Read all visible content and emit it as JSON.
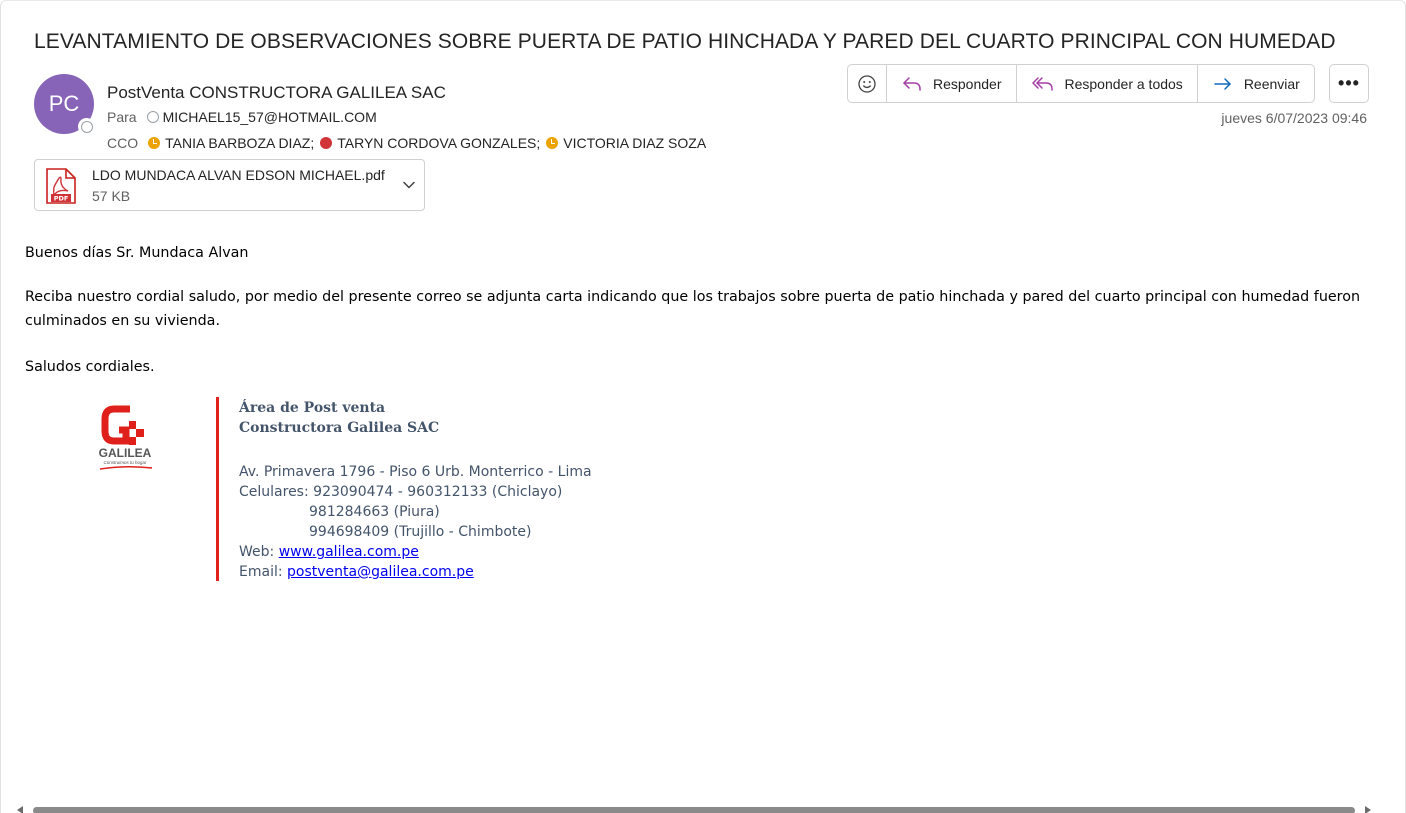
{
  "message": {
    "subject": "LEVANTAMIENTO DE OBSERVACIONES SOBRE PUERTA DE PATIO HINCHADA Y PARED DEL CUARTO PRINCIPAL CON HUMEDAD",
    "avatar_initials": "PC",
    "avatar_color": "#8764b8",
    "sender": "PostVenta CONSTRUCTORA GALILEA SAC",
    "to_label": "Para",
    "to": [
      {
        "name": "MICHAEL15_57@HOTMAIL.COM",
        "status": "offline"
      }
    ],
    "cc_label": "CCO",
    "cc": [
      {
        "name": "TANIA BARBOZA DIAZ;",
        "status": "away"
      },
      {
        "name": "TARYN CORDOVA GONZALES;",
        "status": "busy"
      },
      {
        "name": "VICTORIA DIAZ SOZA",
        "status": "away"
      }
    ],
    "date": "jueves 6/07/2023 09:46"
  },
  "toolbar": {
    "emoji_icon": "emoji-icon",
    "reply_label": "Responder",
    "reply_all_label": "Responder a todos",
    "forward_label": "Reenviar",
    "more_label": "•••",
    "accent_color": "#a33fa6",
    "forward_color": "#0f6cbd"
  },
  "attachment": {
    "name": "LDO MUNDACA ALVAN EDSON MICHAEL.pdf",
    "size": "57 KB",
    "icon": "pdf-icon"
  },
  "body": {
    "greeting": "Buenos días Sr. Mundaca Alvan",
    "paragraph": "Reciba nuestro cordial saludo, por medio del presente correo se adjunta carta indicando que los trabajos sobre puerta de patio hinchada y pared del cuarto principal con humedad fueron culminados en su vivienda.",
    "closing": "Saludos cordiales."
  },
  "signature": {
    "logo_text": "GALILEA",
    "logo_tagline": "Construimos tu hogar",
    "line1": "Área de Post venta",
    "line2": "Constructora Galilea SAC",
    "address": "Av. Primavera 1796 - Piso 6 Urb. Monterrico - Lima",
    "phones_label": "Celulares: ",
    "phones1": "923090474 - 960312133 (Chiclayo)",
    "phones2": "981284663 (Piura)",
    "phones3": "994698409 (Trujillo - Chimbote)",
    "web_label": "Web: ",
    "web": "www.galilea.com.pe",
    "email_label": "Email: ",
    "email": "postventa@galilea.com.pe",
    "brand_color": "#e0201b"
  }
}
